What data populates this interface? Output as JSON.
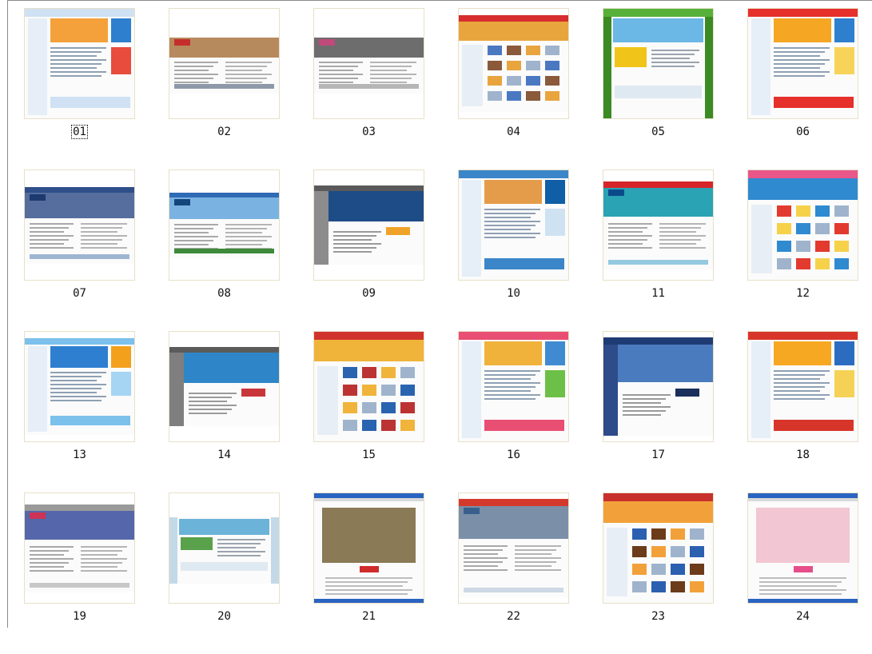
{
  "selected_index": 0,
  "thumbnails": [
    {
      "label": "01",
      "top": "#cfe1f3",
      "main": "#f4a13b",
      "accent": "#2f7fcf",
      "side": "#e74c3c",
      "fill": 1.0,
      "variant": "portal"
    },
    {
      "label": "02",
      "top": "#ffffff",
      "main": "#b78a5e",
      "accent": "#c62d2d",
      "side": "#8d99a8",
      "fill": 0.55,
      "variant": "banner"
    },
    {
      "label": "03",
      "top": "#ffffff",
      "main": "#6d6d6d",
      "accent": "#c04a7a",
      "side": "#b6b6b6",
      "fill": 0.55,
      "variant": "banner"
    },
    {
      "label": "04",
      "top": "#d62d2d",
      "main": "#e9a53d",
      "accent": "#4a79c2",
      "side": "#8a5a3a",
      "fill": 0.88,
      "variant": "shop"
    },
    {
      "label": "05",
      "top": "#56b03a",
      "main": "#6bb8e6",
      "accent": "#f0c419",
      "side": "#3b8a23",
      "fill": 1.0,
      "variant": "green"
    },
    {
      "label": "06",
      "top": "#e5302b",
      "main": "#f5a623",
      "accent": "#2f7fcf",
      "side": "#f7d35a",
      "fill": 1.0,
      "variant": "portal"
    },
    {
      "label": "07",
      "top": "#2f4f8a",
      "main": "#556e9e",
      "accent": "#1d3a6e",
      "side": "#9fb6d3",
      "fill": 0.7,
      "variant": "banner"
    },
    {
      "label": "08",
      "top": "#2f6ab5",
      "main": "#7ab3e2",
      "accent": "#14467d",
      "side": "#3d8a3a",
      "fill": 0.6,
      "variant": "banner"
    },
    {
      "label": "09",
      "top": "#5a5a5a",
      "main": "#1e4c86",
      "accent": "#f0a32a",
      "side": "#8c8c8c",
      "fill": 0.72,
      "variant": "dark"
    },
    {
      "label": "10",
      "top": "#3b86c8",
      "main": "#e49c4a",
      "accent": "#0f5ea6",
      "side": "#cfe2f2",
      "fill": 1.0,
      "variant": "portal"
    },
    {
      "label": "11",
      "top": "#d6252a",
      "main": "#2aa3b5",
      "accent": "#0b4a8a",
      "side": "#94c9e0",
      "fill": 0.8,
      "variant": "banner"
    },
    {
      "label": "12",
      "top": "#e9568a",
      "main": "#2f8ad0",
      "accent": "#e23a2f",
      "side": "#f6d14a",
      "fill": 1.0,
      "variant": "shop"
    },
    {
      "label": "13",
      "top": "#7cc0ec",
      "main": "#2f7fd0",
      "accent": "#f3a11d",
      "side": "#a6d5f3",
      "fill": 0.88,
      "variant": "portal"
    },
    {
      "label": "14",
      "top": "#5b5b5b",
      "main": "#2e86c8",
      "accent": "#c9363a",
      "side": "#7f7f7f",
      "fill": 0.72,
      "variant": "dark"
    },
    {
      "label": "15",
      "top": "#d0342c",
      "main": "#f0b43a",
      "accent": "#2a63b0",
      "side": "#b33",
      "fill": 1.0,
      "variant": "shop"
    },
    {
      "label": "16",
      "top": "#e94f73",
      "main": "#f0b23a",
      "accent": "#3f8ad0",
      "side": "#6cc047",
      "fill": 1.0,
      "variant": "portal"
    },
    {
      "label": "17",
      "top": "#1f3b74",
      "main": "#4b7bbf",
      "accent": "#1a2f5c",
      "side": "#2e4b8a",
      "fill": 0.9,
      "variant": "dark"
    },
    {
      "label": "18",
      "top": "#d8352a",
      "main": "#f7a823",
      "accent": "#2b6cc0",
      "side": "#f5d255",
      "fill": 1.0,
      "variant": "portal"
    },
    {
      "label": "19",
      "top": "#9a9a9a",
      "main": "#5566aa",
      "accent": "#cc3355",
      "side": "#c7c7c7",
      "fill": 0.8,
      "variant": "banner"
    },
    {
      "label": "20",
      "top": "#ffffff",
      "main": "#6bb3d8",
      "accent": "#59a14a",
      "side": "#c4d9e8",
      "fill": 0.65,
      "variant": "green"
    },
    {
      "label": "21",
      "top": "#2a63c0",
      "main": "#8a7a55",
      "accent": "#cf2b2b",
      "side": "#e6e6e6",
      "fill": 1.0,
      "variant": "window"
    },
    {
      "label": "22",
      "top": "#d33a2c",
      "main": "#7b8fa8",
      "accent": "#3a5f8c",
      "side": "#cdd9e4",
      "fill": 0.9,
      "variant": "banner"
    },
    {
      "label": "23",
      "top": "#c8302c",
      "main": "#f2a13a",
      "accent": "#2b5fb0",
      "side": "#6b3b1a",
      "fill": 1.0,
      "variant": "shop"
    },
    {
      "label": "24",
      "top": "#2a63c0",
      "main": "#f2c6d2",
      "accent": "#e54e8a",
      "side": "#e8e8e8",
      "fill": 1.0,
      "variant": "window"
    }
  ]
}
